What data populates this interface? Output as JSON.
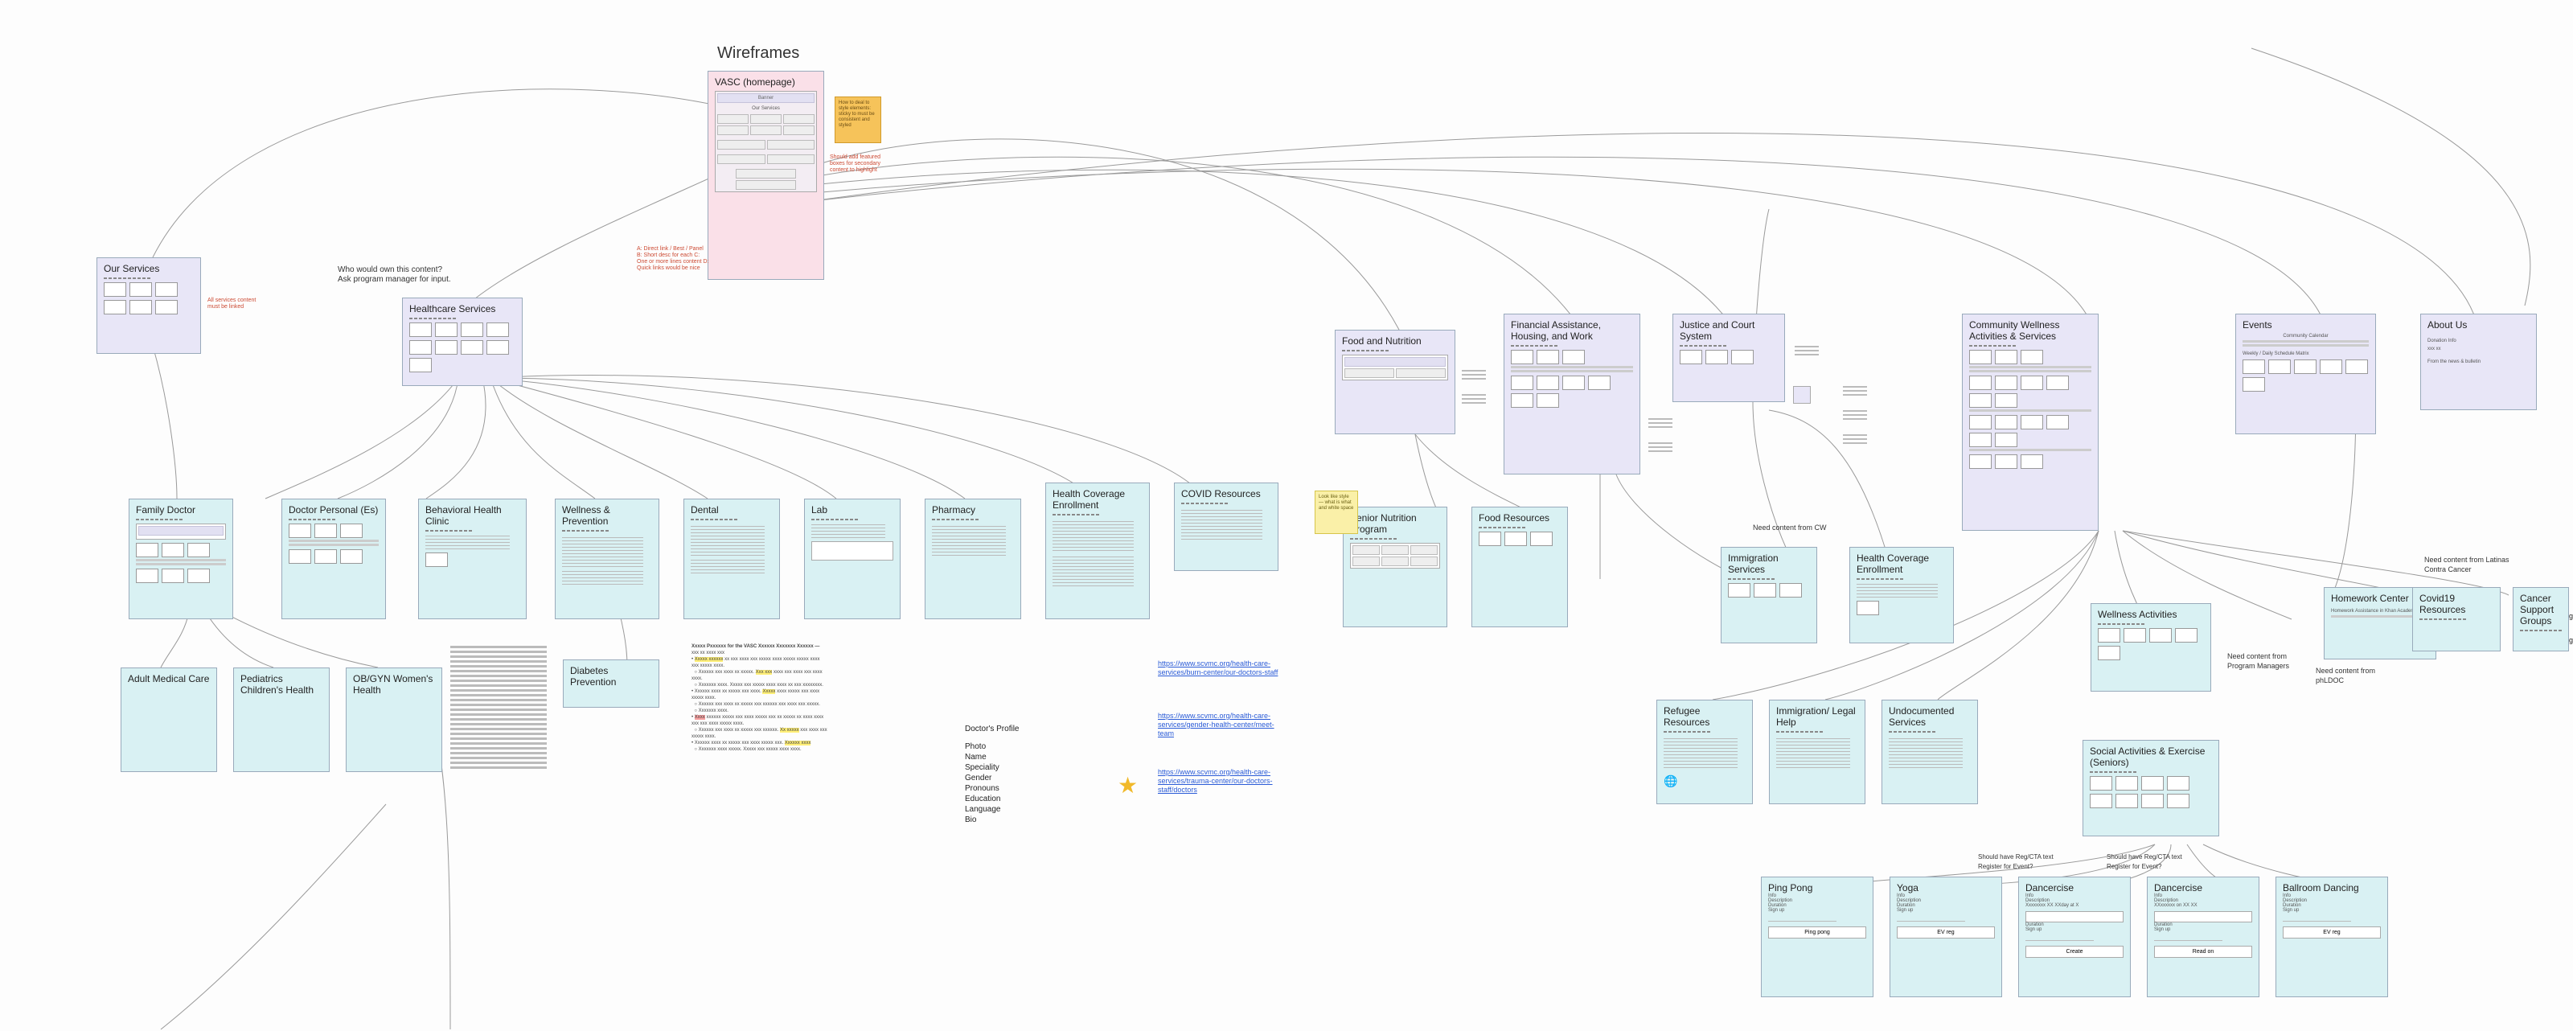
{
  "heading": "Wireframes",
  "homepage": {
    "title": "VASC (homepage)",
    "banner": "Banner",
    "section": "Our Services"
  },
  "sticky_orange": "How to deal to style elements: sticky to must be consistent and styled",
  "sticky_yellow": "Look like style — what is what and white space",
  "annotations": {
    "who_owns": "Who would own this content?\nAsk program manager for input.",
    "homepage_right": "Should add featured boxes for secondary content to highlight",
    "homepage_bottom": "A: Direct link / Best / Panel\nB: Short desc for each\nC: One or more lines content\nD: Quick links would be nice",
    "need_cw": "Need content from CW",
    "need_pm": "Need content from Program Managers",
    "need_phdoc": "Need content from phLDOC",
    "need_latinas": "Need content from Latinas Contra Cancer",
    "scc1": "sccfreetest.org",
    "scc2": "sccfreevax.org",
    "reg1": "Should have Reg/CTA text Register for Event?",
    "reg2": "Should have Reg/CTA text Register for Event?",
    "our_services_side": "All services content must be linked"
  },
  "nodes": {
    "our_services": "Our Services",
    "healthcare": "Healthcare Services",
    "family_doctor": "Family Doctor",
    "doctor_personal": "Doctor Personal (Es)",
    "behavioral": "Behavioral Health Clinic",
    "wellness_prev": "Wellness & Prevention",
    "dental": "Dental",
    "lab": "Lab",
    "pharmacy": "Pharmacy",
    "health_cov": "Health Coverage Enrollment",
    "covid": "COVID Resources",
    "adult_med": "Adult Medical Care",
    "pediatrics": "Pediatrics Children's Health",
    "obgyn": "OB/GYN Women's Health",
    "diabetes": "Diabetes Prevention",
    "food_nut": "Food and Nutrition",
    "fin_assist": "Financial Assistance, Housing, and Work",
    "justice": "Justice and Court System",
    "comm_well": "Community Wellness Activities & Services",
    "events": "Events",
    "about": "About Us",
    "senior_nut": "Senior Nutrition Program",
    "food_res": "Food Resources",
    "immig_svc": "Immigration Services",
    "health_cov2": "Health Coverage Enrollment",
    "wellness_act": "Wellness Activities",
    "refugee": "Refugee Resources",
    "immig_legal": "Immigration/ Legal Help",
    "undoc": "Undocumented Services",
    "homework": "Homework Center",
    "covid19": "Covid19 Resources",
    "cancer": "Cancer Support Groups",
    "social_act": "Social Activities & Exercise (Seniors)",
    "pingpong": "Ping Pong",
    "yoga": "Yoga",
    "dancercise1": "Dancercise",
    "dancercise2": "Dancercise",
    "ballroom": "Ballroom Dancing"
  },
  "doctor_profile": {
    "heading": "Doctor's Profile",
    "fields": [
      "Photo",
      "Name",
      "Speciality",
      "Gender",
      "Pronouns",
      "Education",
      "Language",
      "Bio"
    ]
  },
  "external_links": {
    "l1": "https://www.scvmc.org/health-care-services/burn-center/our-doctors-staff",
    "l2": "https://www.scvmc.org/health-care-services/gender-health-center/meet-team",
    "l3": "https://www.scvmc.org/health-care-services/trauma-center/our-doctors-staff/doctors"
  },
  "events_card": {
    "cal": "Community Calendar",
    "weekly": "Weekly / Daily Schedule Matrix"
  },
  "about_card": {
    "l1": "Donation Info",
    "l2": "From the news & bulletin"
  },
  "activity": {
    "labels": [
      "Info",
      "Description",
      "Duration",
      "Sign up"
    ],
    "btn_ping": "Ping pong",
    "btn_yoga": "EV reg",
    "btn_dance": "Create",
    "btn_ball": "EV reg",
    "btn_read": "Read on",
    "d1_line": "Xxxxxxxx XX XXday at X",
    "d2_line": "XXxxxxxx on XX XX"
  },
  "homework_sub": "Homework Assistance in Khan Academy"
}
